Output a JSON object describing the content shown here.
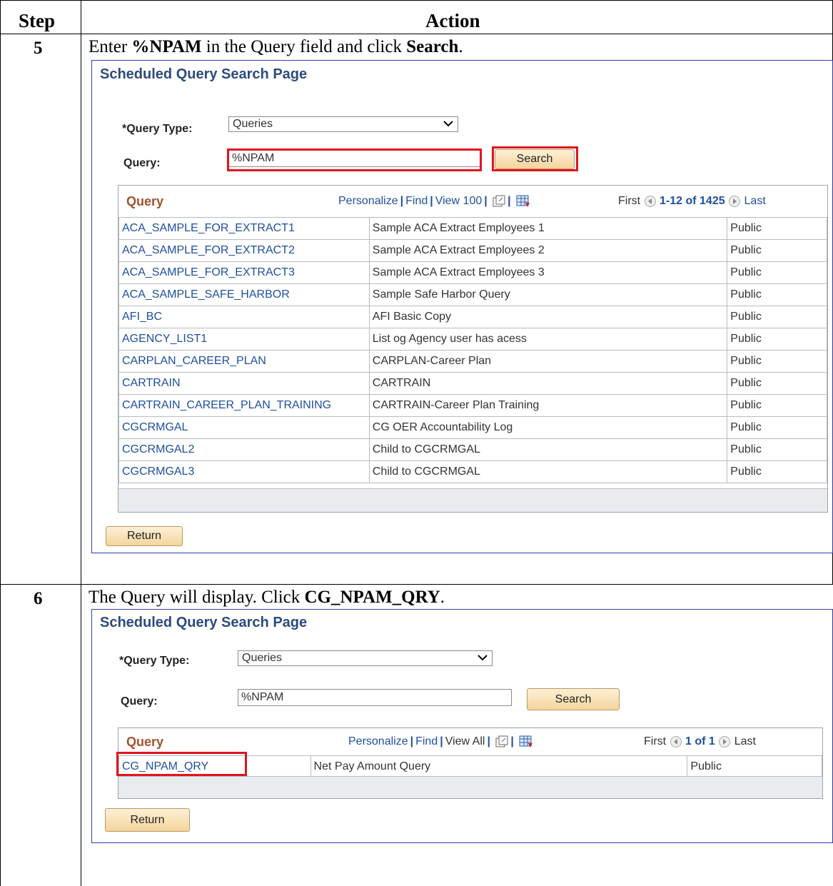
{
  "header": {
    "step": "Step",
    "action": "Action"
  },
  "step5": {
    "number": "5",
    "instr": {
      "pre": "Enter ",
      "b1": "%NPAM",
      "mid": " in the Query field and click ",
      "b2": "Search",
      "post": "."
    },
    "panel": {
      "title": "Scheduled Query Search Page",
      "query_type_label": "*Query Type:",
      "query_type_value": "Queries",
      "query_label": "Query:",
      "query_value": "%NPAM",
      "search_label": "Search",
      "grid": {
        "title": "Query",
        "personalize": "Personalize",
        "find": "Find",
        "view": "View 100",
        "first": "First",
        "range": "1-12 of 1425",
        "last": "Last",
        "rows": [
          [
            "ACA_SAMPLE_FOR_EXTRACT1",
            "Sample ACA Extract Employees 1",
            "Public"
          ],
          [
            "ACA_SAMPLE_FOR_EXTRACT2",
            "Sample ACA Extract Employees 2",
            "Public"
          ],
          [
            "ACA_SAMPLE_FOR_EXTRACT3",
            "Sample ACA Extract Employees 3",
            "Public"
          ],
          [
            "ACA_SAMPLE_SAFE_HARBOR",
            "Sample Safe Harbor Query",
            "Public"
          ],
          [
            "AFI_BC",
            "AFI Basic Copy",
            "Public"
          ],
          [
            "AGENCY_LIST1",
            "List og Agency user has acess",
            "Public"
          ],
          [
            "CARPLAN_CAREER_PLAN",
            "CARPLAN-Career Plan",
            "Public"
          ],
          [
            "CARTRAIN",
            "CARTRAIN",
            "Public"
          ],
          [
            "CARTRAIN_CAREER_PLAN_TRAINING",
            "CARTRAIN-Career Plan Training",
            "Public"
          ],
          [
            "CGCRMGAL",
            "CG OER Accountability Log",
            "Public"
          ],
          [
            "CGCRMGAL2",
            "Child to CGCRMGAL",
            "Public"
          ],
          [
            "CGCRMGAL3",
            "Child to CGCRMGAL",
            "Public"
          ]
        ]
      },
      "return_label": "Return"
    }
  },
  "step6": {
    "number": "6",
    "instr": {
      "pre": "The Query will display.  Click ",
      "b1": "CG_NPAM_QRY",
      "post": "."
    },
    "panel": {
      "title": "Scheduled Query Search Page",
      "query_type_label": "*Query Type:",
      "query_type_value": "Queries",
      "query_label": "Query:",
      "query_value": "%NPAM",
      "search_label": "Search",
      "grid": {
        "title": "Query",
        "personalize": "Personalize",
        "find": "Find",
        "view": "View All",
        "first": "First",
        "range": "1 of 1",
        "last": "Last",
        "rows": [
          [
            "CG_NPAM_QRY",
            "Net Pay Amount Query",
            "Public"
          ]
        ]
      },
      "return_label": "Return"
    }
  },
  "colors": {
    "highlight": "#e0141e",
    "link": "#1f4fa0",
    "panel_border": "#2f3f9e"
  }
}
